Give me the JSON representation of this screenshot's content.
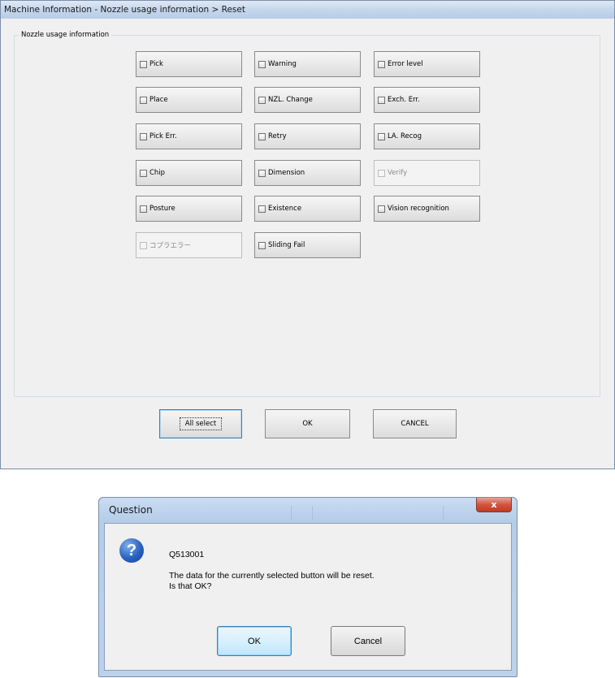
{
  "main_window": {
    "title": "Machine Information - Nozzle usage information > Reset",
    "group_title": "Nozzle usage information",
    "checkboxes": [
      {
        "label": "Pick",
        "enabled": true
      },
      {
        "label": "Warning",
        "enabled": true
      },
      {
        "label": "Error level",
        "enabled": true
      },
      {
        "label": "Place",
        "enabled": true
      },
      {
        "label": "NZL. Change",
        "enabled": true
      },
      {
        "label": "Exch. Err.",
        "enabled": true
      },
      {
        "label": "Pick Err.",
        "enabled": true
      },
      {
        "label": "Retry",
        "enabled": true
      },
      {
        "label": "LA. Recog",
        "enabled": true
      },
      {
        "label": "Chip",
        "enabled": true
      },
      {
        "label": "Dimension",
        "enabled": true
      },
      {
        "label": "Verify",
        "enabled": false
      },
      {
        "label": "Posture",
        "enabled": true
      },
      {
        "label": "Existence",
        "enabled": true
      },
      {
        "label": "Vision recognition",
        "enabled": true
      },
      {
        "label": "コプラエラー",
        "enabled": false
      },
      {
        "label": "Sliding Fail",
        "enabled": true
      }
    ],
    "buttons": {
      "all_select": "All select",
      "ok": "OK",
      "cancel": "CANCEL"
    }
  },
  "dialog": {
    "title": "Question",
    "close_glyph": "x",
    "icon_glyph": "?",
    "code": "Q513001",
    "message_line1": "The data for the currently selected button will be reset.",
    "message_line2": "Is that OK?",
    "ok_label": "OK",
    "cancel_label": "Cancel"
  }
}
